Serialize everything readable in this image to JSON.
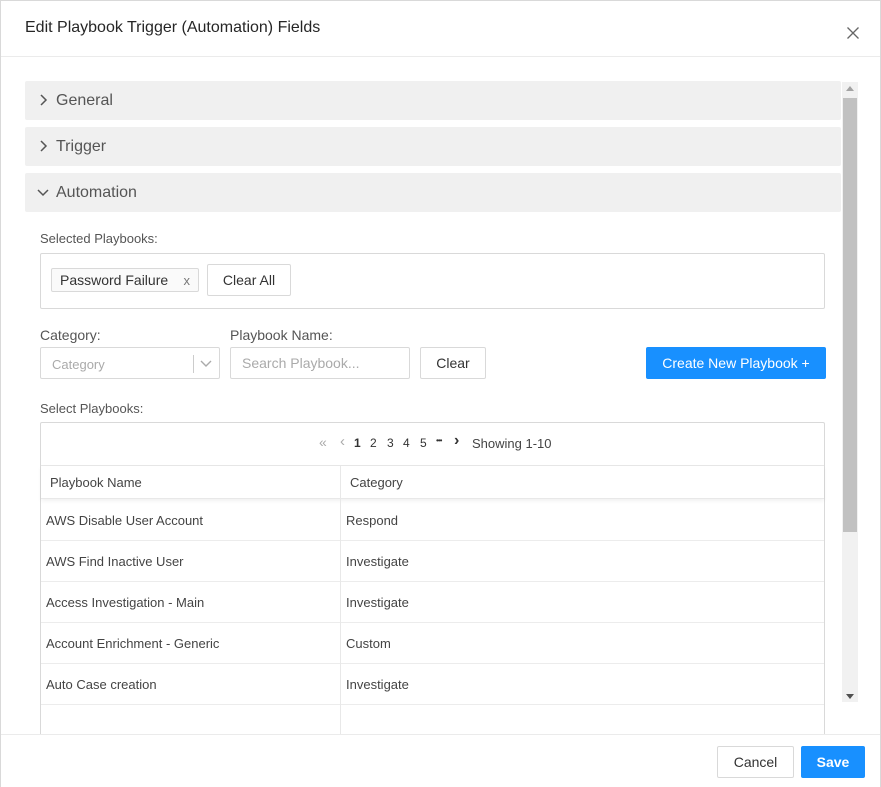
{
  "dialog": {
    "title": "Edit Playbook Trigger (Automation) Fields",
    "close_icon": "close-icon"
  },
  "sections": [
    {
      "label": "General",
      "expanded": false
    },
    {
      "label": "Trigger",
      "expanded": false
    },
    {
      "label": "Automation",
      "expanded": true
    }
  ],
  "automation": {
    "selected_label": "Selected Playbooks:",
    "selected_tags": [
      {
        "label": "Password Failure",
        "remove_icon": "x"
      }
    ],
    "clear_all_label": "Clear All",
    "category_label": "Category:",
    "category_placeholder": "Category",
    "playbook_name_label": "Playbook Name:",
    "search_placeholder": "Search Playbook...",
    "clear_label": "Clear",
    "create_label": "Create New Playbook +",
    "select_label": "Select Playbooks:"
  },
  "pagination": {
    "first_icon": "«",
    "prev_icon": "‹",
    "pages": [
      "1",
      "2",
      "3",
      "4",
      "5"
    ],
    "active_page": "1",
    "ellipsis": "•••",
    "next_icon": "›",
    "showing": "Showing 1-10"
  },
  "table": {
    "columns": [
      "Playbook Name",
      "Category"
    ],
    "rows": [
      [
        "AWS Disable User Account",
        "Respond"
      ],
      [
        "AWS Find Inactive User",
        "Investigate"
      ],
      [
        "Access Investigation - Main",
        "Investigate"
      ],
      [
        "Account Enrichment - Generic",
        "Custom"
      ],
      [
        "Auto Case creation",
        "Investigate"
      ]
    ]
  },
  "footer": {
    "cancel_label": "Cancel",
    "save_label": "Save"
  },
  "colors": {
    "primary": "#1890ff",
    "section_bg": "#f0f0f0",
    "border": "#d9d9d9"
  }
}
